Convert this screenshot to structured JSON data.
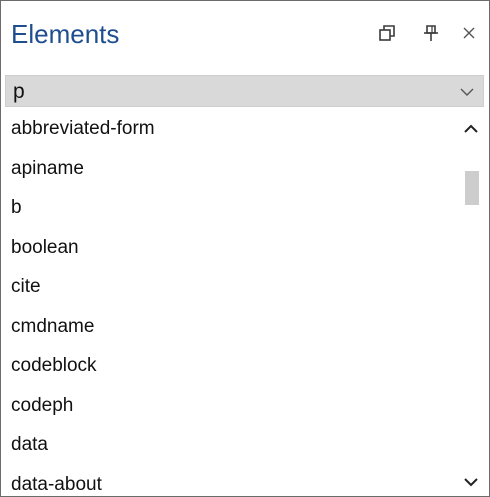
{
  "window": {
    "title": "Elements"
  },
  "title_bar": {
    "buttons": [
      {
        "name": "float-window-icon"
      },
      {
        "name": "pin-icon"
      },
      {
        "name": "close-icon"
      }
    ]
  },
  "selector": {
    "value": "p"
  },
  "elements": [
    "abbreviated-form",
    "apiname",
    "b",
    "boolean",
    "cite",
    "cmdname",
    "codeblock",
    "codeph",
    "data",
    "data-about"
  ],
  "colors": {
    "title": "#1f4e8f",
    "selector_bg": "#d9d9d9",
    "scroll_thumb": "#cdcdcd",
    "icon": "#3a3a3a"
  }
}
